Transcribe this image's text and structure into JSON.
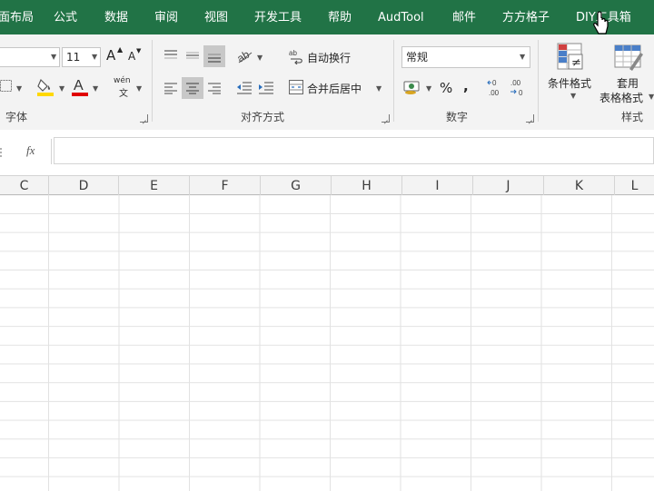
{
  "menu": {
    "items": [
      "面布局",
      "公式",
      "数据",
      "审阅",
      "视图",
      "开发工具",
      "帮助",
      "AudTool",
      "邮件",
      "方方格子",
      "DIY工具箱"
    ]
  },
  "ribbon": {
    "font": {
      "size_value": "11",
      "grow_label": "A",
      "shrink_label": "A",
      "phonetic_top": "wén",
      "phonetic_bottom": "文",
      "group_label": "字体",
      "fill_color": "#ffd800",
      "font_color": "#e00000"
    },
    "alignment": {
      "wrap_text_label": "自动换行",
      "merge_center_label": "合并后居中",
      "group_label": "对齐方式"
    },
    "number": {
      "format_value": "常规",
      "percent_label": "%",
      "comma_label": ",",
      "inc_decimal_label": "←0 .00",
      "dec_decimal_label": ".00 →0",
      "group_label": "数字"
    },
    "styles": {
      "cond_format_label": "条件格式",
      "table_format_line1": "套用",
      "table_format_line2": "表格格式",
      "group_label": "样式"
    }
  },
  "formula_bar": {
    "fx_label": "fx",
    "value": ""
  },
  "columns": [
    "C",
    "D",
    "E",
    "F",
    "G",
    "H",
    "I",
    "J",
    "K",
    "L"
  ],
  "colors": {
    "accent": "#217346"
  }
}
